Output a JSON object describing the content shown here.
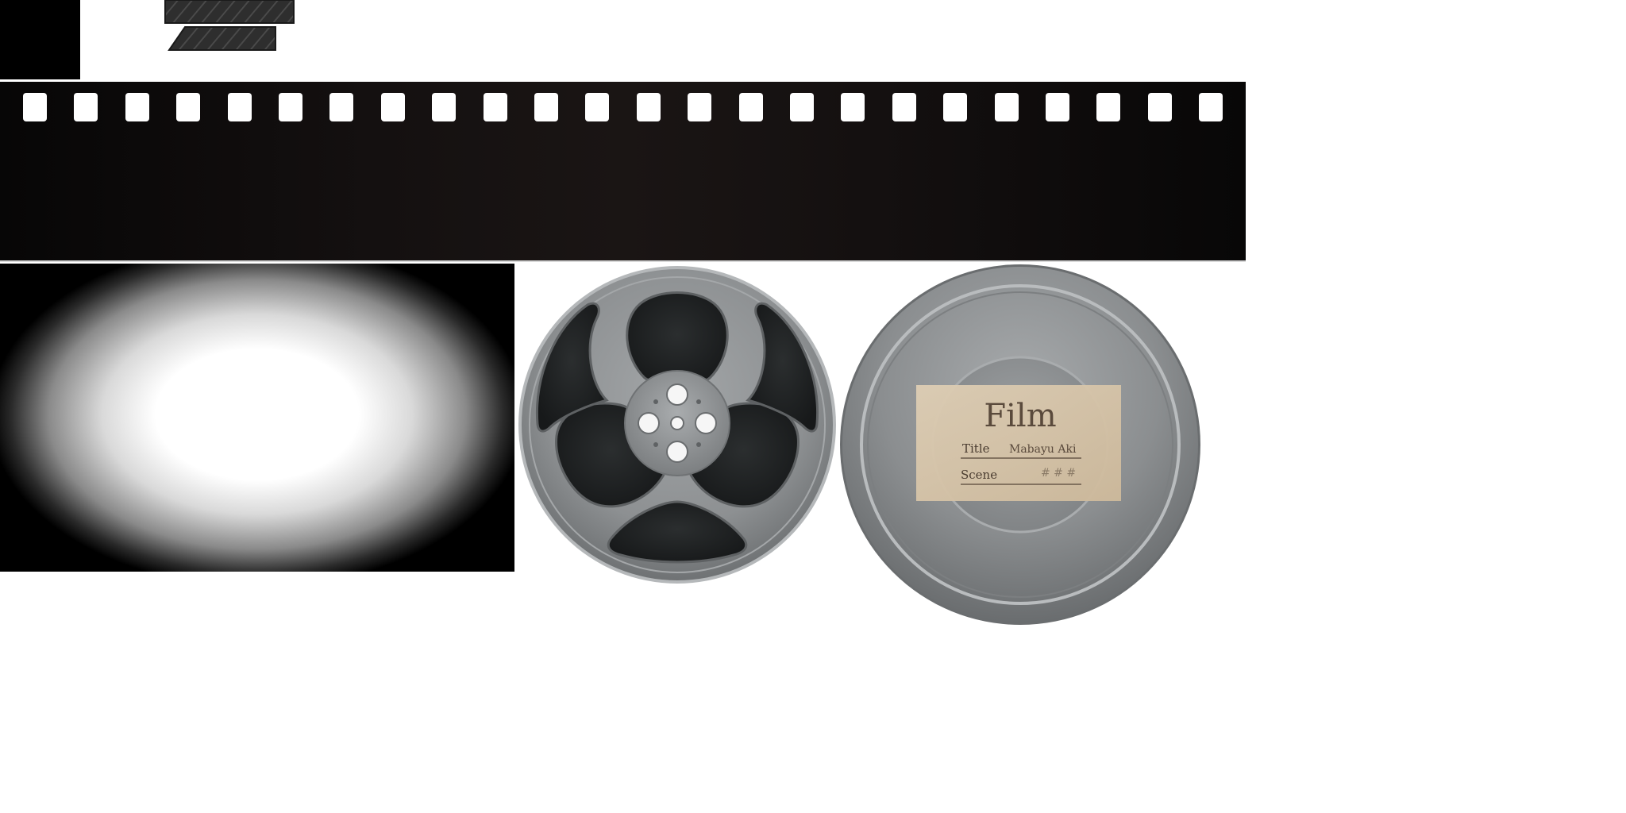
{
  "label": {
    "heading": "Film",
    "title_label": "Title",
    "title_value": "Mabayu Aki",
    "scene_label": "Scene",
    "scene_value": "# # #"
  },
  "colors": {
    "film": "#140f0e",
    "reel_metal": "#8f9294",
    "reel_dark": "#222425",
    "label_paper": "#d9c8ae",
    "label_ink": "#5a4a3c"
  },
  "icons": {
    "reel": "film-reel-icon",
    "can": "film-canister-icon",
    "slate": "clapper-stick-icon"
  }
}
